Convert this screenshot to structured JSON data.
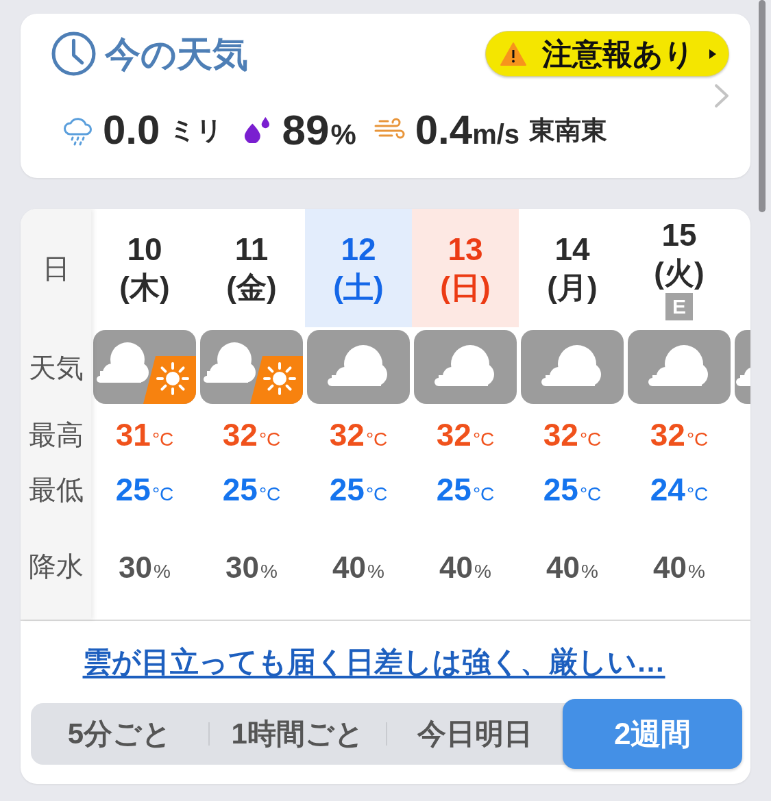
{
  "current": {
    "title": "今の天気",
    "alert": {
      "label": "注意報あり"
    },
    "precipitation": {
      "value": "0.0",
      "unit": "ミリ"
    },
    "humidity": {
      "value": "89",
      "unit": "%"
    },
    "wind": {
      "value": "0.4",
      "unit": "m/s",
      "direction": "東南東"
    }
  },
  "forecast": {
    "row_labels": [
      "日",
      "天気",
      "最高",
      "最低",
      "降水"
    ],
    "days": [
      {
        "date": "10",
        "weekday": "(木)",
        "kind": "weekday",
        "weather": {
          "kind": "cloudy_sunny"
        },
        "high": {
          "value": "31",
          "unit": "°C"
        },
        "low": {
          "value": "25",
          "unit": "°C"
        },
        "precipitation": {
          "value": "30",
          "unit": "%"
        }
      },
      {
        "date": "11",
        "weekday": "(金)",
        "kind": "weekday",
        "weather": {
          "kind": "cloudy_sunny"
        },
        "high": {
          "value": "32",
          "unit": "°C"
        },
        "low": {
          "value": "25",
          "unit": "°C"
        },
        "precipitation": {
          "value": "30",
          "unit": "%"
        }
      },
      {
        "date": "12",
        "weekday": "(土)",
        "kind": "saturday",
        "weather": {
          "kind": "cloudy"
        },
        "high": {
          "value": "32",
          "unit": "°C"
        },
        "low": {
          "value": "25",
          "unit": "°C"
        },
        "precipitation": {
          "value": "40",
          "unit": "%"
        }
      },
      {
        "date": "13",
        "weekday": "(日)",
        "kind": "sunday",
        "weather": {
          "kind": "cloudy"
        },
        "high": {
          "value": "32",
          "unit": "°C"
        },
        "low": {
          "value": "25",
          "unit": "°C"
        },
        "precipitation": {
          "value": "40",
          "unit": "%"
        }
      },
      {
        "date": "14",
        "weekday": "(月)",
        "kind": "weekday",
        "weather": {
          "kind": "cloudy"
        },
        "high": {
          "value": "32",
          "unit": "°C"
        },
        "low": {
          "value": "25",
          "unit": "°C"
        },
        "precipitation": {
          "value": "40",
          "unit": "%"
        }
      },
      {
        "date": "15",
        "weekday": "(火)",
        "kind": "weekday",
        "badge": "E",
        "weather": {
          "kind": "cloudy"
        },
        "high": {
          "value": "32",
          "unit": "°C"
        },
        "low": {
          "value": "24",
          "unit": "°C"
        },
        "precipitation": {
          "value": "40",
          "unit": "%"
        }
      }
    ],
    "next_day": {
      "weather": {
        "kind": "cloudy"
      }
    },
    "summary_link": "雲が目立っても届く日差しは強く、厳しい…",
    "tabs": [
      {
        "label": "5分ごと",
        "selected": false
      },
      {
        "label": "1時間ごと",
        "selected": false
      },
      {
        "label": "今日明日",
        "selected": false
      },
      {
        "label": "2週間",
        "selected": true
      }
    ]
  }
}
